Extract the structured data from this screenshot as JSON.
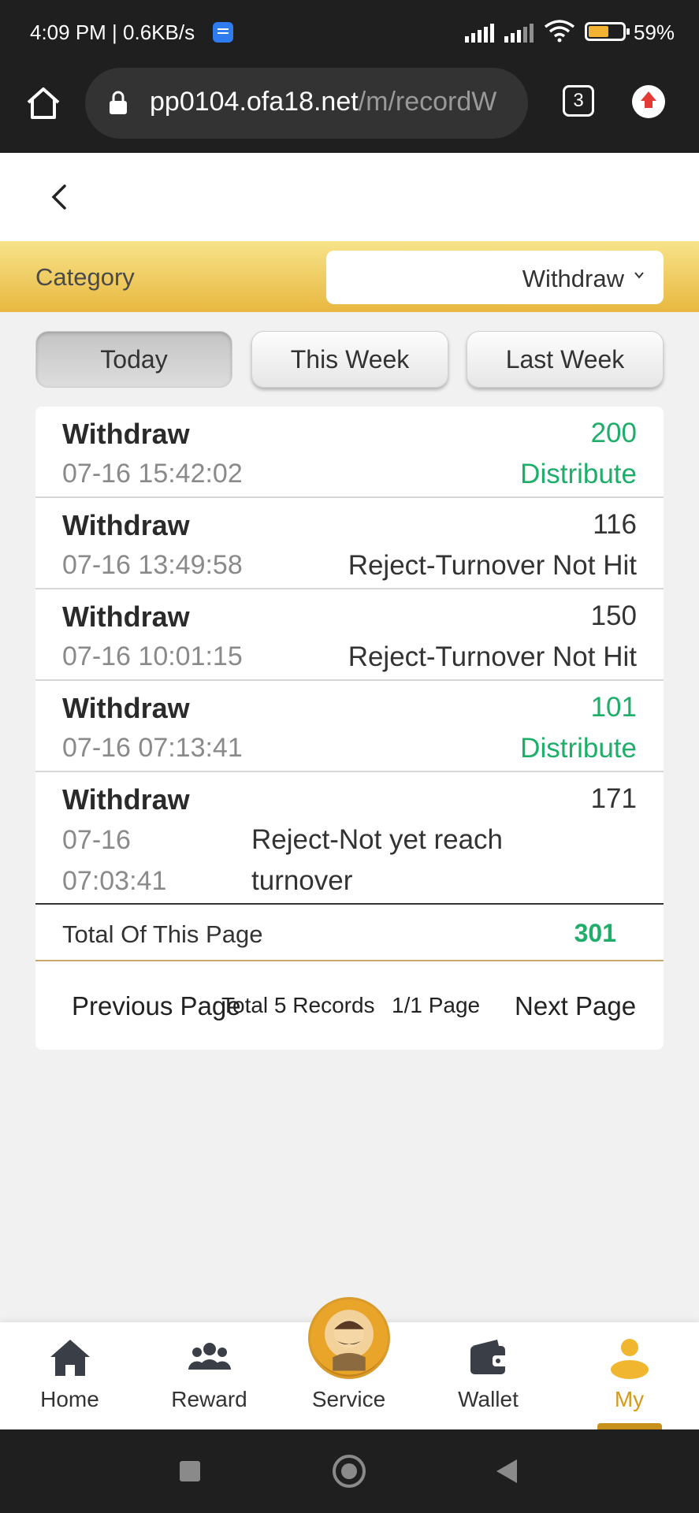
{
  "status_bar": {
    "time": "4:09 PM | 0.6KB/s",
    "battery": "59%",
    "battery_level": 0.59
  },
  "browser": {
    "url_main": "pp0104.ofa18.net",
    "url_path": "/m/recordW",
    "tab_count": "3"
  },
  "filter": {
    "category_label": "Category",
    "category_value": "Withdraw"
  },
  "date_tabs": [
    {
      "label": "Today",
      "active": true
    },
    {
      "label": "This Week",
      "active": false
    },
    {
      "label": "Last Week",
      "active": false
    }
  ],
  "records": [
    {
      "type": "Withdraw",
      "amount": "200",
      "datetime": "07-16 15:42:02",
      "status": "Distribute"
    },
    {
      "type": "Withdraw",
      "amount": "116",
      "datetime": "07-16 13:49:58",
      "status": "Reject-Turnover Not Hit"
    },
    {
      "type": "Withdraw",
      "amount": "150",
      "datetime": "07-16 10:01:15",
      "status": "Reject-Turnover Not Hit"
    },
    {
      "type": "Withdraw",
      "amount": "101",
      "datetime": "07-16 07:13:41",
      "status": "Distribute"
    },
    {
      "type": "Withdraw",
      "amount": "171",
      "datetime": "07-16 07:03:41",
      "status": "Reject-Not yet reach turnover"
    }
  ],
  "total": {
    "label": "Total Of This Page",
    "value": "301"
  },
  "pager": {
    "prev": "Previous Page",
    "total_records": "Total 5 Records",
    "page": "1/1 Page",
    "next": "Next Page"
  },
  "bottom_nav": [
    {
      "label": "Home",
      "icon": "home-icon"
    },
    {
      "label": "Reward",
      "icon": "users-icon"
    },
    {
      "label": "Service",
      "icon": "service-avatar"
    },
    {
      "label": "Wallet",
      "icon": "wallet-icon"
    },
    {
      "label": "My",
      "icon": "user-icon",
      "active": true
    }
  ],
  "colors": {
    "accent": "#d59a19",
    "success": "#1fae6a",
    "header_gold": "#e8b840"
  }
}
